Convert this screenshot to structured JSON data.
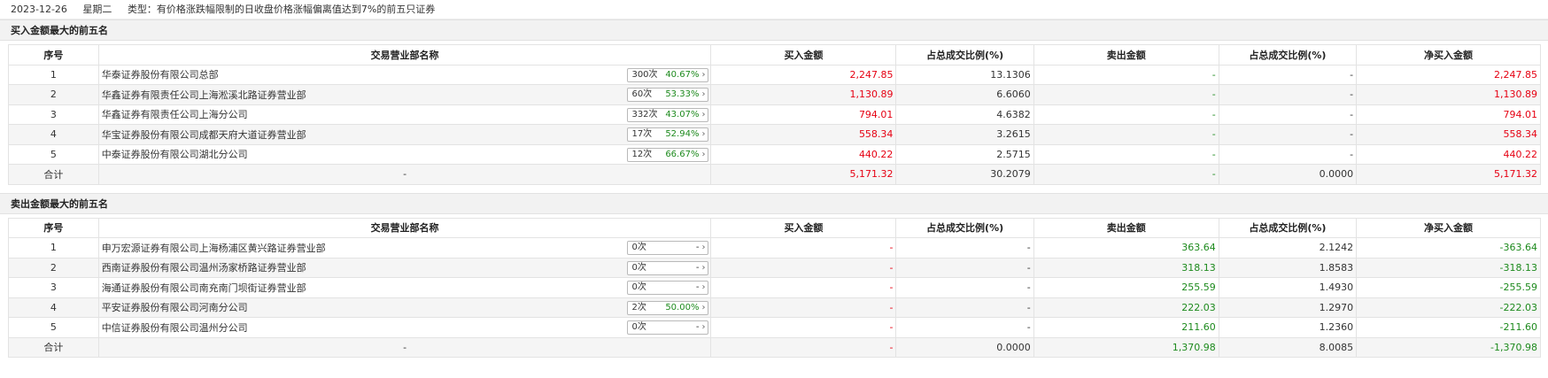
{
  "header": {
    "date": "2023-12-26",
    "weekday": "星期二",
    "type": "类型：有价格涨跌幅限制的日收盘价格涨幅偏离值达到7%的前五只证券"
  },
  "columns": [
    "序号",
    "交易营业部名称",
    "买入金额",
    "占总成交比例(%)",
    "卖出金额",
    "占总成交比例(%)",
    "净买入金额"
  ],
  "buy_section": {
    "title": "买入金额最大的前五名",
    "rows": [
      {
        "no": "1",
        "name": "华泰证券股份有限公司总部",
        "count": "300次",
        "rate": "40.67%",
        "arrow": "›",
        "buy": "2,247.85",
        "buy_pct": "13.1306",
        "sell": "-",
        "sell_pct": "-",
        "net": "2,247.85"
      },
      {
        "no": "2",
        "name": "华鑫证券有限责任公司上海淞溪北路证券营业部",
        "count": "60次",
        "rate": "53.33%",
        "arrow": "›",
        "buy": "1,130.89",
        "buy_pct": "6.6060",
        "sell": "-",
        "sell_pct": "-",
        "net": "1,130.89"
      },
      {
        "no": "3",
        "name": "华鑫证券有限责任公司上海分公司",
        "count": "332次",
        "rate": "43.07%",
        "arrow": "›",
        "buy": "794.01",
        "buy_pct": "4.6382",
        "sell": "-",
        "sell_pct": "-",
        "net": "794.01"
      },
      {
        "no": "4",
        "name": "华宝证券股份有限公司成都天府大道证券营业部",
        "count": "17次",
        "rate": "52.94%",
        "arrow": "›",
        "buy": "558.34",
        "buy_pct": "3.2615",
        "sell": "-",
        "sell_pct": "-",
        "net": "558.34"
      },
      {
        "no": "5",
        "name": "中泰证券股份有限公司湖北分公司",
        "count": "12次",
        "rate": "66.67%",
        "arrow": "›",
        "buy": "440.22",
        "buy_pct": "2.5715",
        "sell": "-",
        "sell_pct": "-",
        "net": "440.22"
      }
    ],
    "total": {
      "label": "合计",
      "name": "-",
      "buy": "5,171.32",
      "buy_pct": "30.2079",
      "sell": "-",
      "sell_pct": "0.0000",
      "net": "5,171.32"
    }
  },
  "sell_section": {
    "title": "卖出金额最大的前五名",
    "rows": [
      {
        "no": "1",
        "name": "申万宏源证券有限公司上海杨浦区黄兴路证券营业部",
        "count": "0次",
        "rate": "-",
        "arrow": "›",
        "buy": "-",
        "buy_pct": "-",
        "sell": "363.64",
        "sell_pct": "2.1242",
        "net": "-363.64"
      },
      {
        "no": "2",
        "name": "西南证券股份有限公司温州汤家桥路证券营业部",
        "count": "0次",
        "rate": "-",
        "arrow": "›",
        "buy": "-",
        "buy_pct": "-",
        "sell": "318.13",
        "sell_pct": "1.8583",
        "net": "-318.13"
      },
      {
        "no": "3",
        "name": "海通证券股份有限公司南充南门坝街证券营业部",
        "count": "0次",
        "rate": "-",
        "arrow": "›",
        "buy": "-",
        "buy_pct": "-",
        "sell": "255.59",
        "sell_pct": "1.4930",
        "net": "-255.59"
      },
      {
        "no": "4",
        "name": "平安证券股份有限公司河南分公司",
        "count": "2次",
        "rate": "50.00%",
        "arrow": "›",
        "buy": "-",
        "buy_pct": "-",
        "sell": "222.03",
        "sell_pct": "1.2970",
        "net": "-222.03"
      },
      {
        "no": "5",
        "name": "中信证券股份有限公司温州分公司",
        "count": "0次",
        "rate": "-",
        "arrow": "›",
        "buy": "-",
        "buy_pct": "-",
        "sell": "211.60",
        "sell_pct": "1.2360",
        "net": "-211.60"
      }
    ],
    "total": {
      "label": "合计",
      "name": "-",
      "buy": "-",
      "buy_pct": "0.0000",
      "sell": "1,370.98",
      "sell_pct": "8.0085",
      "net": "-1,370.98"
    }
  },
  "colors": {
    "up": "#e60012",
    "down": "#1d8a1d"
  }
}
